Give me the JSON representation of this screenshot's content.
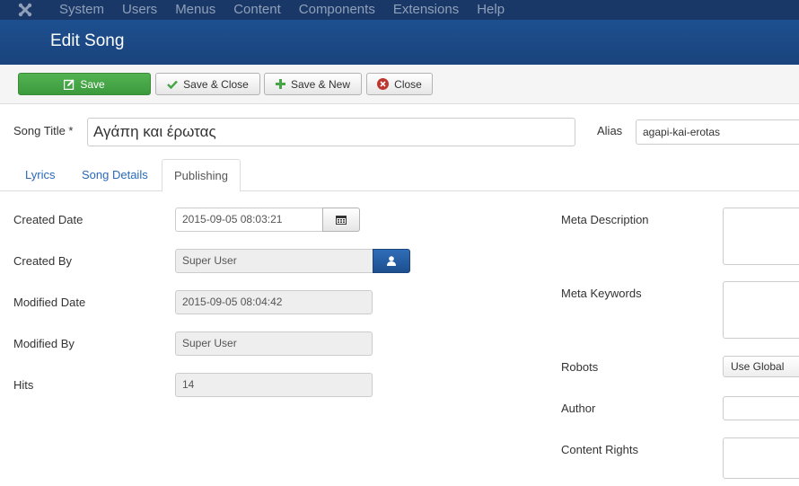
{
  "nav": {
    "logo_icon": "joomla-logo-icon",
    "items": [
      "System",
      "Users",
      "Menus",
      "Content",
      "Components",
      "Extensions",
      "Help"
    ]
  },
  "header": {
    "title": "Edit Song"
  },
  "toolbar": {
    "save": "Save",
    "save_close": "Save & Close",
    "save_new": "Save & New",
    "close": "Close"
  },
  "form": {
    "title_label": "Song Title *",
    "title_value": "Αγάπη και έρωτας",
    "alias_label": "Alias",
    "alias_value": "agapi-kai-erotas"
  },
  "tabs": [
    "Lyrics",
    "Song Details",
    "Publishing"
  ],
  "publishing": {
    "created_date_label": "Created Date",
    "created_date_value": "2015-09-05 08:03:21",
    "created_by_label": "Created By",
    "created_by_value": "Super User",
    "modified_date_label": "Modified Date",
    "modified_date_value": "2015-09-05 08:04:42",
    "modified_by_label": "Modified By",
    "modified_by_value": "Super User",
    "hits_label": "Hits",
    "hits_value": "14"
  },
  "metadata": {
    "meta_description_label": "Meta Description",
    "meta_keywords_label": "Meta Keywords",
    "robots_label": "Robots",
    "robots_value": "Use Global",
    "author_label": "Author",
    "content_rights_label": "Content Rights"
  },
  "colors": {
    "nav_bg": "#1a3867",
    "header_bg": "#1c4a85",
    "save_green": "#46a546",
    "link_blue": "#2a69b8"
  }
}
